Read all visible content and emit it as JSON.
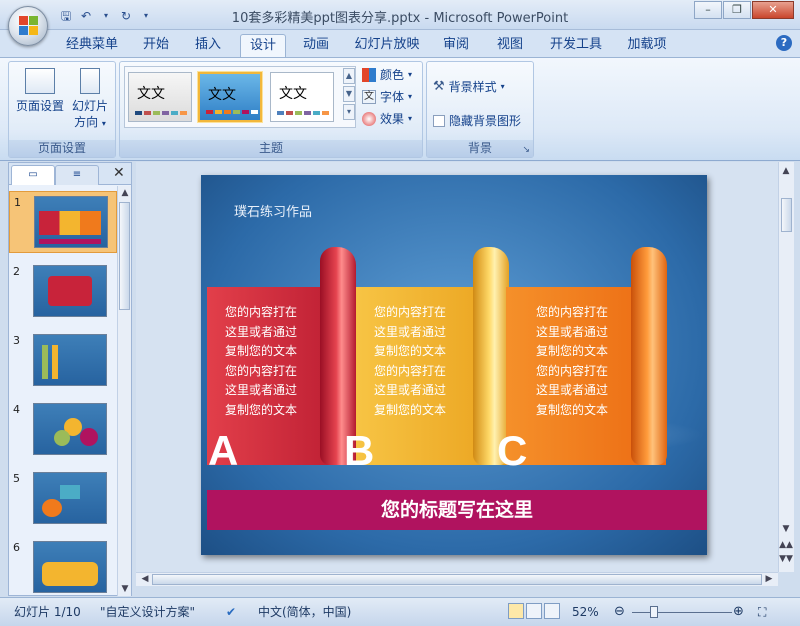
{
  "window": {
    "title": "10套多彩精美ppt图表分享.pptx - Microsoft PowerPoint"
  },
  "ribbon_tabs": [
    "经典菜单",
    "开始",
    "插入",
    "设计",
    "动画",
    "幻灯片放映",
    "审阅",
    "视图",
    "开发工具",
    "加载项"
  ],
  "active_tab": "设计",
  "groups": {
    "page_setup": {
      "label": "页面设置",
      "page_setup_btn": "页面设置",
      "orientation_btn_l1": "幻灯片",
      "orientation_btn_l2": "方向"
    },
    "themes": {
      "label": "主题",
      "theme_sample_text": "文文",
      "colors": "颜色",
      "fonts": "字体",
      "effects": "效果"
    },
    "background": {
      "label": "背景",
      "styles": "背景样式",
      "hide": "隐藏背景图形"
    }
  },
  "slide_numbers": [
    "1",
    "2",
    "3",
    "4",
    "5",
    "6"
  ],
  "slide": {
    "author": "璞石练习作品",
    "body_text": "您的内容打在\n这里或者通过\n复制您的文本\n您的内容打在\n这里或者通过\n复制您的文本",
    "letters": [
      "A",
      "B",
      "C"
    ],
    "title": "您的标题写在这里"
  },
  "status": {
    "slide": "幻灯片 1/10",
    "theme": "\"自定义设计方案\"",
    "language": "中文(简体，中国)",
    "zoom": "52%"
  },
  "colors": {
    "red": "#c8233a",
    "yellow": "#f3b52f",
    "orange": "#f07a1c",
    "title_bar": "#b0135f"
  }
}
